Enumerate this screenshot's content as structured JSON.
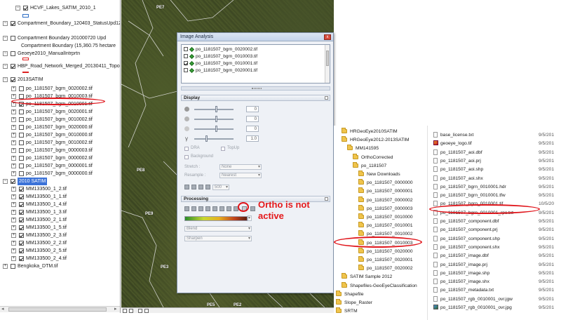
{
  "toc": {
    "rows": [
      {
        "label": "HCVF_Lakes_SATIM_2010_1",
        "toggle": "−",
        "checked": true
      },
      {
        "label": "Compartment_Boundary_120403_StatusUpd12",
        "toggle": "−",
        "checked": true
      },
      {
        "label": "Compartment Boundary 201000720 Upd",
        "toggle": "−",
        "checked": false
      },
      {
        "label": "Compartment Boundary (15,360.75 hectare",
        "toggle": "",
        "checked": null
      },
      {
        "label": "Geoeye2010_ManualIntrprtn",
        "toggle": "−",
        "checked": false
      },
      {
        "label": "HBP_Road_Network_Merged_20130411_Topol",
        "toggle": "−",
        "checked": true
      },
      {
        "label": "2013SATIM",
        "toggle": "−",
        "checked": true
      },
      {
        "label": "po_1181507_bgrn_0020002.tif",
        "toggle": "+",
        "checked": false
      },
      {
        "label": "po_1181507_bgrn_0010003.tif",
        "toggle": "+",
        "checked": false
      },
      {
        "label": "po_1181507_bgrn_0010001.tif",
        "toggle": "+",
        "checked": true
      },
      {
        "label": "po_1181507_bgrn_0020001.tif",
        "toggle": "+",
        "checked": false
      },
      {
        "label": "po_1181507_bgrn_0010002.tif",
        "toggle": "+",
        "checked": false
      },
      {
        "label": "po_1181507_bgrn_0020000.tif",
        "toggle": "+",
        "checked": false
      },
      {
        "label": "po_1181507_bgrn_0010000.tif",
        "toggle": "+",
        "checked": false
      },
      {
        "label": "po_1181507_bgrn_0010002.tif",
        "toggle": "+",
        "checked": false
      },
      {
        "label": "po_1181507_bgrn_0000003.tif",
        "toggle": "+",
        "checked": false
      },
      {
        "label": "po_1181507_bgrn_0000002.tif",
        "toggle": "+",
        "checked": false
      },
      {
        "label": "po_1181507_bgrn_0000001.tif",
        "toggle": "+",
        "checked": false
      },
      {
        "label": "po_1181507_bgrn_0000000.tif",
        "toggle": "+",
        "checked": false
      },
      {
        "label": "2010 SATIM",
        "toggle": "−",
        "checked": true
      },
      {
        "label": "MM133500_1_2.tif",
        "toggle": "+",
        "checked": true
      },
      {
        "label": "MM133500_1_1.tif",
        "toggle": "+",
        "checked": true
      },
      {
        "label": "MM133500_1_4.tif",
        "toggle": "+",
        "checked": true
      },
      {
        "label": "MM133500_1_3.tif",
        "toggle": "+",
        "checked": true
      },
      {
        "label": "MM133500_2_1.tif",
        "toggle": "+",
        "checked": true
      },
      {
        "label": "MM133500_1_5.tif",
        "toggle": "+",
        "checked": true
      },
      {
        "label": "MM133500_2_3.tif",
        "toggle": "+",
        "checked": true
      },
      {
        "label": "MM133500_2_2.tif",
        "toggle": "+",
        "checked": true
      },
      {
        "label": "MM133500_2_5.tif",
        "toggle": "+",
        "checked": true
      },
      {
        "label": "MM133500_2_4.tif",
        "toggle": "+",
        "checked": true
      },
      {
        "label": "Bengkoka_DTM.tif",
        "toggle": "+",
        "checked": false
      }
    ]
  },
  "map": {
    "labels": [
      "PE7",
      "PE8",
      "PE9",
      "PE3",
      "PE5",
      "PE2"
    ]
  },
  "image_analysis": {
    "title": "Image Analysis",
    "close": "x",
    "list_items": [
      {
        "label": "po_1181507_bgrn_0020002.tif",
        "checked": false
      },
      {
        "label": "po_1181507_bgrn_0010003.tif",
        "checked": false
      },
      {
        "label": "po_1181507_bgrn_0010001.tif",
        "checked": true
      },
      {
        "label": "po_1181507_bgrn_0020001.tif",
        "checked": false
      }
    ],
    "display_header": "Display",
    "slider_values": [
      "0",
      "0",
      "0",
      "1.0"
    ],
    "gamma_symbol": "γ",
    "dra_label": "DRA",
    "topup_label": "TopUp",
    "background_label": "Background",
    "stretch_label": "Stretch :",
    "stretch_value": "None",
    "resample_label": "Resample :",
    "resample_value": "Nearest",
    "zoom_value": "500",
    "processing_header": "Processing",
    "blend_value": "Blend",
    "sharpen_value": "Sharpen"
  },
  "annotation": "Ortho is not active",
  "explorer": {
    "tree": [
      {
        "label": "HRGeoEye2010SATIM",
        "indent": 0
      },
      {
        "label": "HRGeoEye2012-2013SATIM",
        "indent": 0
      },
      {
        "label": "MM141595",
        "indent": 1
      },
      {
        "label": "OrthoCorrected",
        "indent": 2
      },
      {
        "label": "po_1181507",
        "indent": 2
      },
      {
        "label": "New Downloads",
        "indent": 3
      },
      {
        "label": "po_1181507_0000000",
        "indent": 3
      },
      {
        "label": "po_1181507_0000001",
        "indent": 3
      },
      {
        "label": "po_1181507_0000002",
        "indent": 3
      },
      {
        "label": "po_1181507_0000003",
        "indent": 3
      },
      {
        "label": "po_1181507_0010000",
        "indent": 3
      },
      {
        "label": "po_1181507_0010001",
        "indent": 3
      },
      {
        "label": "po_1181507_0010002",
        "indent": 3
      },
      {
        "label": "po_1181507_0010003",
        "indent": 3
      },
      {
        "label": "po_1181507_0020000",
        "indent": 3
      },
      {
        "label": "po_1181507_0020001",
        "indent": 3
      },
      {
        "label": "po_1181507_0020002",
        "indent": 3
      },
      {
        "label": "SATIM Sample 2012",
        "indent": 0
      },
      {
        "label": "Shapefiles-GeoEyeClassification",
        "indent": 0
      },
      {
        "label": "Shapefile",
        "indent": -1
      },
      {
        "label": "Slope_Raster",
        "indent": -1
      },
      {
        "label": "SRTM",
        "indent": -1
      }
    ],
    "files": [
      {
        "name": "base_license.txt",
        "date": "9/5/201",
        "icon": "file"
      },
      {
        "name": "geoeye_logo.tif",
        "date": "9/5/201",
        "icon": "logo"
      },
      {
        "name": "po_1181507_aoi.dbf",
        "date": "9/5/201",
        "icon": "file"
      },
      {
        "name": "po_1181507_aoi.prj",
        "date": "9/5/201",
        "icon": "file"
      },
      {
        "name": "po_1181507_aoi.shp",
        "date": "9/5/201",
        "icon": "file"
      },
      {
        "name": "po_1181507_aoi.shx",
        "date": "9/5/201",
        "icon": "file"
      },
      {
        "name": "po_1181507_bgrn_0010001.hdr",
        "date": "9/5/201",
        "icon": "file"
      },
      {
        "name": "po_1181507_bgrn_0010001.tfw",
        "date": "9/5/201",
        "icon": "file"
      },
      {
        "name": "po_1181507_bgrn_0010001.tif",
        "date": "10/5/20",
        "icon": "file"
      },
      {
        "name": "po_1181507_bgrn_0010001_rpc.txt",
        "date": "9/5/201",
        "icon": "file"
      },
      {
        "name": "po_1181507_component.dbf",
        "date": "9/5/201",
        "icon": "file"
      },
      {
        "name": "po_1181507_component.prj",
        "date": "9/5/201",
        "icon": "file"
      },
      {
        "name": "po_1181507_component.shp",
        "date": "9/5/201",
        "icon": "file"
      },
      {
        "name": "po_1181507_component.shx",
        "date": "9/5/201",
        "icon": "file"
      },
      {
        "name": "po_1181507_image.dbf",
        "date": "9/5/201",
        "icon": "file"
      },
      {
        "name": "po_1181507_image.prj",
        "date": "9/5/201",
        "icon": "file"
      },
      {
        "name": "po_1181507_image.shp",
        "date": "9/5/201",
        "icon": "file"
      },
      {
        "name": "po_1181507_image.shx",
        "date": "9/5/201",
        "icon": "file"
      },
      {
        "name": "po_1181507_metadata.txt",
        "date": "9/5/201",
        "icon": "file"
      },
      {
        "name": "po_1181507_rgb_0010001_ovr.jgw",
        "date": "9/5/201",
        "icon": "file"
      },
      {
        "name": "po_1181507_rgb_0010001_ovr.jpg",
        "date": "9/5/201",
        "icon": "img"
      }
    ]
  },
  "colors": {
    "highlight_ellipse": "#e0151b",
    "selection": "#3b72d8"
  }
}
